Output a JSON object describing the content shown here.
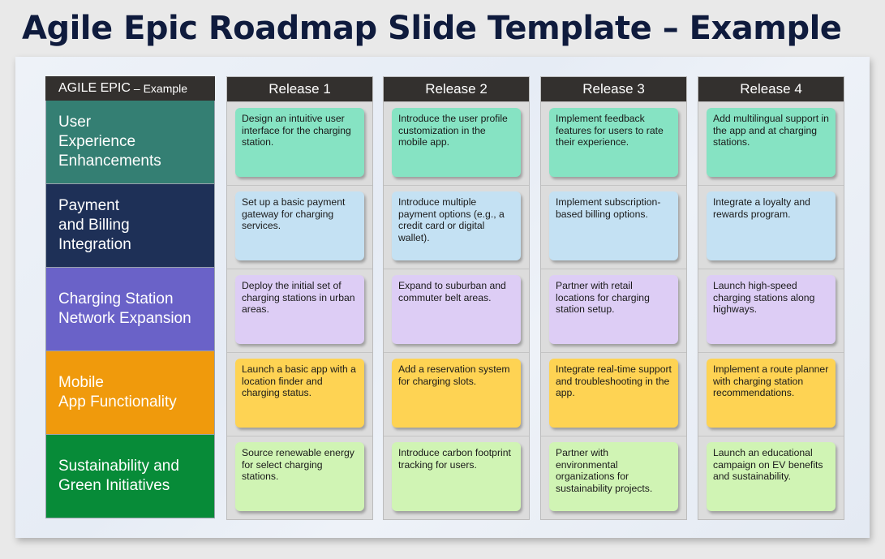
{
  "page": {
    "title": "Agile Epic Roadmap Slide Template – Example"
  },
  "epic_header": {
    "main": "AGILE EPIC",
    "suffix": "– Example"
  },
  "releases": [
    {
      "label": "Release 1"
    },
    {
      "label": "Release 2"
    },
    {
      "label": "Release 3"
    },
    {
      "label": "Release 4"
    }
  ],
  "epics": [
    {
      "name": "User Experience Enhancements",
      "lines": [
        "User",
        "Experience",
        "Enhancements"
      ],
      "color": "#347f73",
      "card_color": "#86e3c3",
      "items": [
        "Design an intuitive user interface for the charging station.",
        "Introduce the user profile customization in the mobile app.",
        "Implement feedback features for users to rate their experience.",
        "Add multilingual support in the app and at charging stations."
      ]
    },
    {
      "name": "Payment and Billing Integration",
      "lines": [
        "Payment",
        "and Billing",
        "Integration"
      ],
      "color": "#1e3057",
      "card_color": "#c4e1f3",
      "items": [
        "Set up a basic payment gateway for charging services.",
        "Introduce multiple payment options (e.g., a credit card or digital wallet).",
        "Implement subscription-based billing options.",
        "Integrate a loyalty and rewards program."
      ]
    },
    {
      "name": "Charging Station Network Expansion",
      "lines": [
        "Charging Station",
        "Network Expansion"
      ],
      "color": "#6a62c8",
      "card_color": "#ddcdf5",
      "items": [
        "Deploy the initial set of charging stations in urban areas.",
        "Expand to suburban and commuter belt areas.",
        "Partner with retail locations for charging station setup.",
        "Launch high-speed charging stations along highways."
      ]
    },
    {
      "name": "Mobile App Functionality",
      "lines": [
        "Mobile",
        "App Functionality"
      ],
      "color": "#f09a0c",
      "card_color": "#fed353",
      "items": [
        "Launch a basic app with a location finder and charging status.",
        "Add a reservation system for charging slots.",
        "Integrate real-time support and troubleshooting in the app.",
        "Implement a route planner with charging station recommendations."
      ]
    },
    {
      "name": "Sustainability and Green Initiatives",
      "lines": [
        "Sustainability and",
        "Green Initiatives"
      ],
      "color": "#078b38",
      "card_color": "#d0f4b4",
      "items": [
        "Source renewable energy for select charging stations.",
        "Introduce carbon footprint tracking for users.",
        "Partner with environmental organizations for sustainability projects.",
        "Launch an educational campaign on EV benefits and sustainability."
      ]
    }
  ]
}
